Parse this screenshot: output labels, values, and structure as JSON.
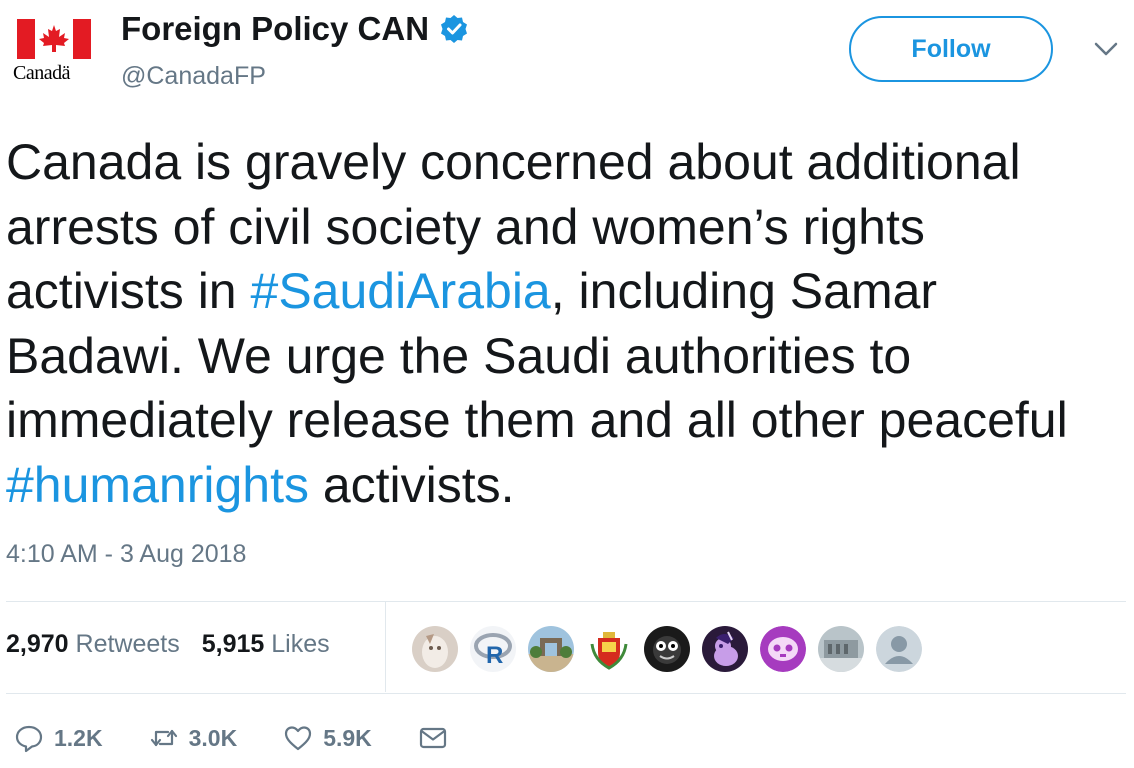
{
  "account": {
    "display_name": "Foreign Policy CAN",
    "handle": "@CanadaFP",
    "logo_word": "Canadä"
  },
  "follow_label": "Follow",
  "tweet": {
    "parts": [
      "Canada is gravely concerned about additional arrests of civil society and women’s rights activists in ",
      "#SaudiArabia",
      ", including Samar Badawi. We urge the Saudi authorities to immediately release them and all other peaceful ",
      "#humanrights",
      " activists."
    ],
    "timestamp": "4:10 AM - 3 Aug 2018"
  },
  "stats": {
    "retweets_count": "2,970",
    "retweets_label": "Retweets",
    "likes_count": "5,915",
    "likes_label": "Likes"
  },
  "actions": {
    "reply_count": "1.2K",
    "retweet_count": "3.0K",
    "like_count": "5.9K"
  },
  "colors": {
    "accent": "#1b95e0",
    "text": "#14171a",
    "muted": "#657786",
    "flag_red": "#e31b23"
  }
}
